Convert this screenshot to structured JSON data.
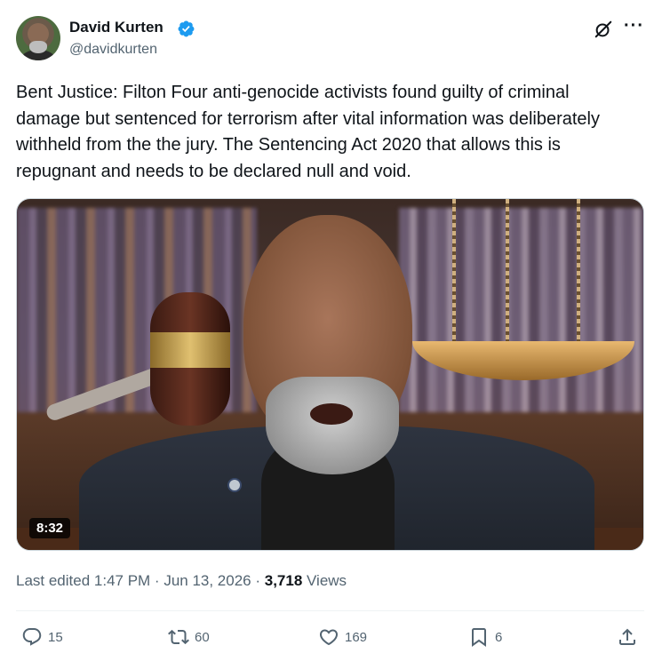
{
  "author": {
    "name": "David Kurten",
    "handle": "@davidkurten",
    "verified_color": "#1d9bf0"
  },
  "tweet": {
    "text": "Bent Justice: Filton Four anti-genocide activists found guilty of criminal damage but sentenced for terrorism after vital information was deliberately withheld from the the jury. The Sentencing Act 2020 that allows this is repugnant and needs to be declared null and void."
  },
  "media": {
    "duration": "8:32"
  },
  "meta": {
    "edited": "Last edited 1:47 PM · Jun 13, 2026 · ",
    "views_count": "3,718",
    "views_label": " Views"
  },
  "actions": {
    "replies": "15",
    "reposts": "60",
    "likes": "169",
    "bookmarks": "6"
  },
  "icons": [
    "grok-icon",
    "more-icon",
    "verified-badge-icon",
    "reply-icon",
    "repost-icon",
    "like-icon",
    "bookmark-icon",
    "share-icon"
  ],
  "colors": {
    "text": "#0f1419",
    "secondary": "#536471",
    "accent": "#1d9bf0"
  }
}
